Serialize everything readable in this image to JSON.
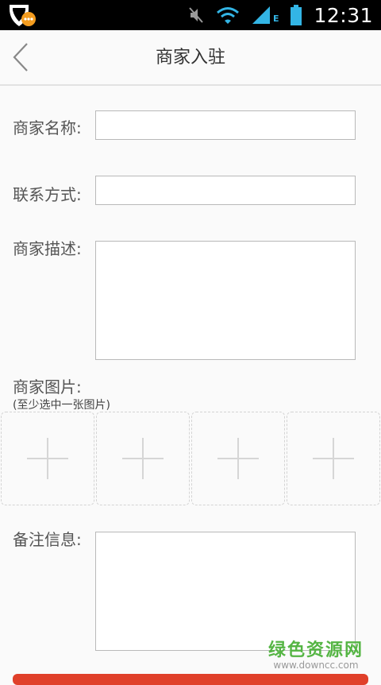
{
  "status_bar": {
    "time": "12:31",
    "network_type": "E",
    "icons": [
      "app-badge-icon",
      "mute-icon",
      "wifi-icon",
      "signal-icon",
      "battery-icon"
    ]
  },
  "header": {
    "title": "商家入驻",
    "back_icon": "chevron-left-icon"
  },
  "form": {
    "name": {
      "label": "商家名称:",
      "value": ""
    },
    "contact": {
      "label": "联系方式:",
      "value": ""
    },
    "description": {
      "label": "商家描述:",
      "value": ""
    },
    "images": {
      "label": "商家图片:",
      "hint": "(至少选中一张图片)",
      "slots": [
        "add-photo",
        "add-photo",
        "add-photo",
        "add-photo"
      ]
    },
    "remarks": {
      "label": "备注信息:",
      "value": ""
    }
  },
  "watermark": {
    "title": "绿色资源网",
    "url": "www.downcc.com"
  },
  "colors": {
    "accent": "#e0402a",
    "badge_orange": "#f39c1f",
    "watermark_green": "#55b544"
  }
}
